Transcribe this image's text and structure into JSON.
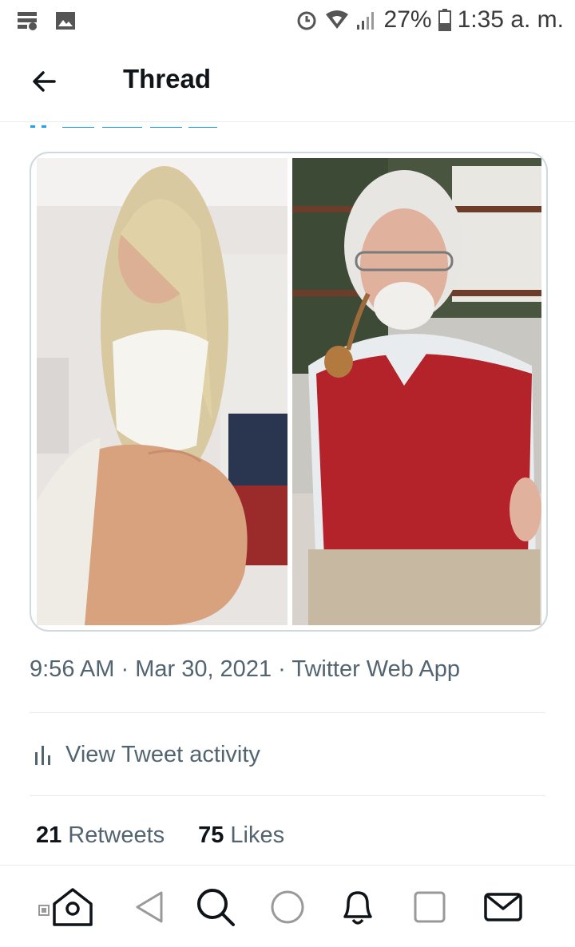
{
  "status_bar": {
    "battery": "27%",
    "time": "1:35 a. m.",
    "icons": [
      "notification-icon",
      "image-icon",
      "alarm-icon",
      "wifi-icon",
      "signal-icon",
      "battery-icon"
    ]
  },
  "header": {
    "title": "Thread",
    "back_icon": "back-arrow-icon"
  },
  "tweet": {
    "media": [
      {
        "name": "left-photo",
        "description_icon": "photo"
      },
      {
        "name": "right-photo",
        "description_icon": "photo"
      }
    ],
    "meta": {
      "time": "9:56 AM",
      "sep1": " · ",
      "date": "Mar 30, 2021",
      "sep2": " · ",
      "source": "Twitter Web App"
    },
    "activity_label": "View Tweet activity",
    "retweets_count": "21",
    "retweets_label": "Retweets",
    "likes_count": "75",
    "likes_label": "Likes"
  },
  "bottom_nav": [
    "home-icon",
    "back-triangle-icon",
    "search-icon",
    "home-circle-icon",
    "notifications-bell-icon",
    "recents-square-icon",
    "messages-envelope-icon"
  ],
  "colors": {
    "accent": "#1da1f2",
    "text_primary": "#0f1419",
    "text_secondary": "#536471",
    "border": "#cfd9de"
  }
}
